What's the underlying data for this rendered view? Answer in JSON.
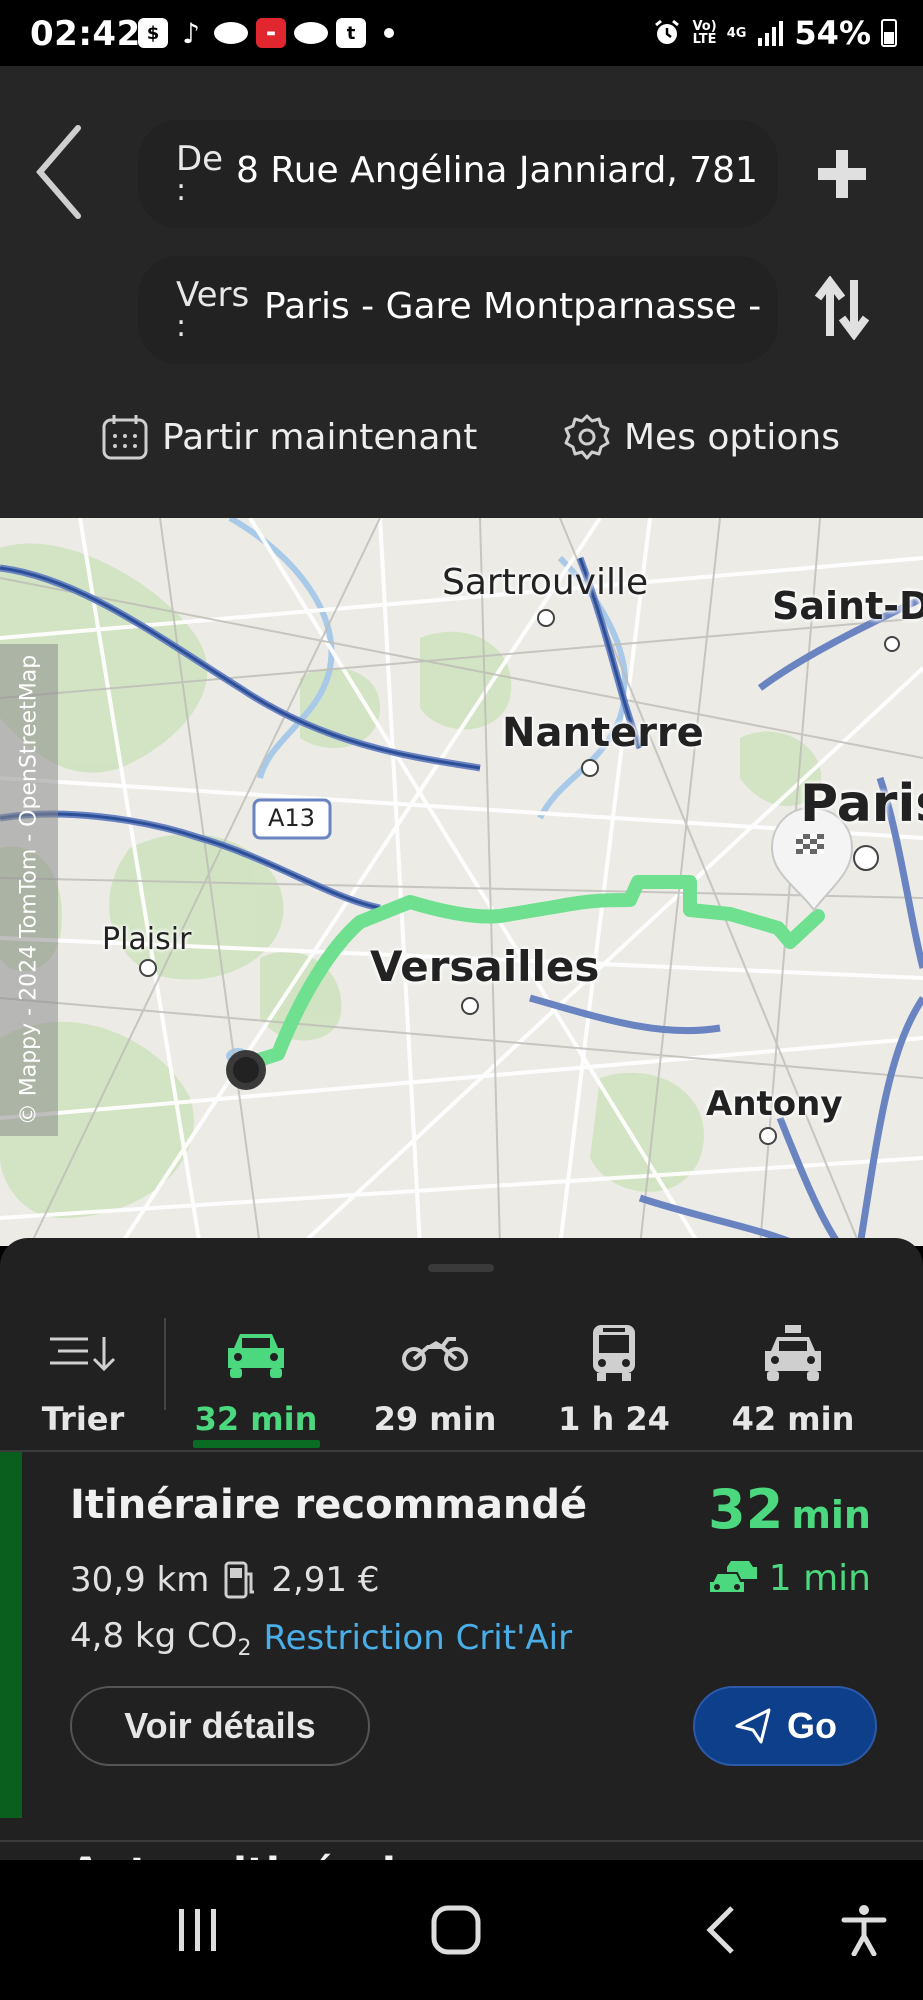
{
  "status_bar": {
    "time": "02:42",
    "battery": "54%",
    "network_top": "Vo)",
    "network_bottom": "LTE",
    "data_type": "4G",
    "app_icons": [
      "payment-app-icon",
      "tiktok-icon",
      "cloud-app-icon",
      "news-app-icon",
      "cloud-app-icon",
      "tumblr-icon"
    ]
  },
  "header": {
    "from_label": "De",
    "from_colon": ":",
    "from_value": "8 Rue Angélina Janniard, 781",
    "to_label": "Vers",
    "to_colon": ":",
    "to_value": "Paris - Gare Montparnasse -",
    "depart_label": "Partir maintenant",
    "options_label": "Mes options"
  },
  "map": {
    "copyright": "© Mappy - 2024 TomTom - OpenStreetMap",
    "road_label": "A13",
    "places": {
      "sartrouville": "Sartrouville",
      "saint_denis": "Saint-D",
      "nanterre": "Nanterre",
      "paris": "Paris",
      "plaisir": "Plaisir",
      "versailles": "Versailles",
      "antony": "Antony"
    },
    "route_color": "#6fe08f"
  },
  "modes": {
    "sort_label": "Trier",
    "items": [
      {
        "label": "32 min",
        "icon": "car-icon",
        "active": true
      },
      {
        "label": "29 min",
        "icon": "motorcycle-icon",
        "active": false
      },
      {
        "label": "1 h 24",
        "icon": "bus-icon",
        "active": false
      },
      {
        "label": "42 min",
        "icon": "taxi-icon",
        "active": false
      }
    ]
  },
  "route": {
    "title": "Itinéraire recommandé",
    "distance": "30,9 km",
    "fuel_cost": "2,91 €",
    "co2": "4,8 kg CO",
    "co2_sub": "2",
    "restriction": "Restriction Crit'Air",
    "duration_value": "32",
    "duration_unit": "min",
    "traffic_delay": "1 min",
    "details_button": "Voir détails",
    "go_button": "Go",
    "next_peek": "Autres itinéraires"
  },
  "colors": {
    "accent_green": "#4cd87e",
    "go_blue": "#0e3f8a",
    "link_blue": "#4aaee8"
  }
}
